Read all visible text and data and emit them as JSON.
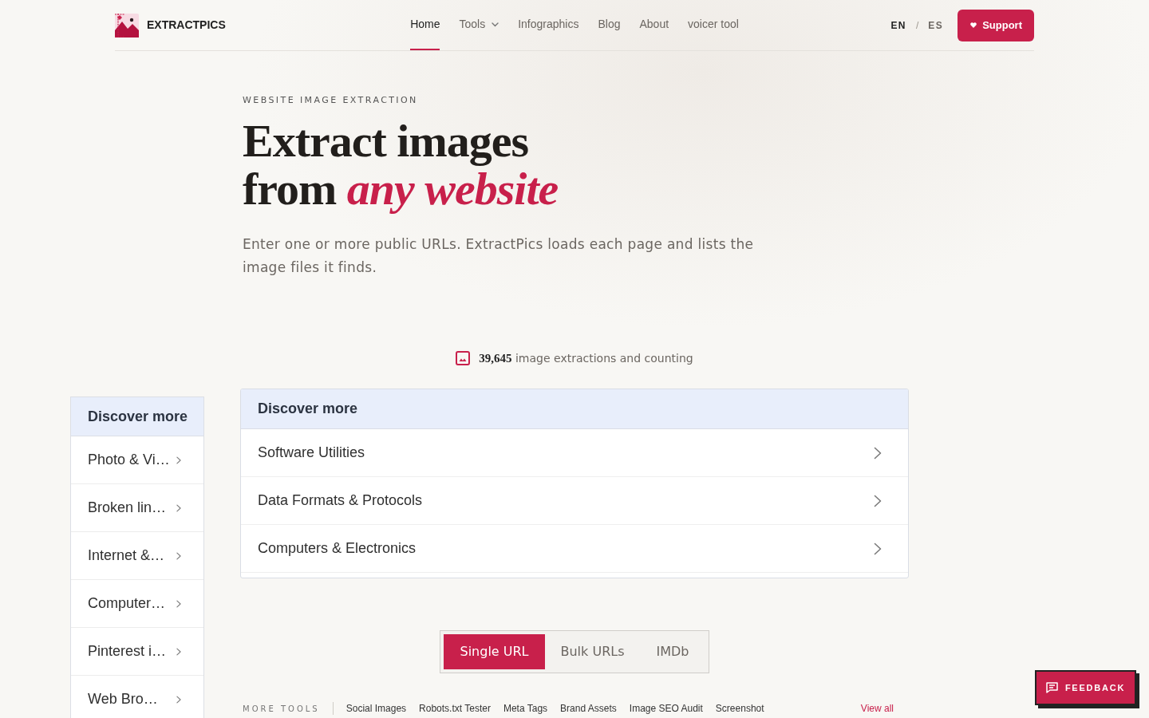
{
  "header": {
    "logo": {
      "text": "EXTRACTPICS"
    },
    "nav": [
      {
        "label": "Home",
        "kind": "link",
        "selected": true
      },
      {
        "label": "Tools",
        "kind": "dropdown",
        "selected": false
      },
      {
        "label": "Infographics",
        "kind": "link",
        "selected": false
      },
      {
        "label": "Blog",
        "kind": "link",
        "selected": false
      },
      {
        "label": "About",
        "kind": "link",
        "selected": false
      },
      {
        "label": "voicer tool",
        "kind": "link",
        "selected": false
      }
    ],
    "languages": [
      {
        "label": "EN",
        "selected": true
      },
      {
        "label": "ES",
        "selected": false
      }
    ],
    "language_separator": "/",
    "support_button": {
      "label": "Support"
    }
  },
  "hero": {
    "eyebrow": "WEBSITE IMAGE EXTRACTION",
    "title_lines": [
      "Extract images",
      "from *any website*"
    ],
    "description": "Enter one or more public URLs. ExtractPics loads each page and lists the image files it finds."
  },
  "counter": {
    "text": "**39,645** image extractions and counting"
  },
  "sidebar": {
    "title": "Discover more",
    "items": [
      {
        "label": "Photo & Vi…"
      },
      {
        "label": "Broken lin…"
      },
      {
        "label": "Internet &…"
      },
      {
        "label": "Computer…"
      },
      {
        "label": "Pinterest i…"
      },
      {
        "label": "Web Bro…"
      }
    ]
  },
  "discover_panel": {
    "title": "Discover more",
    "items": [
      {
        "label": "Software Utilities"
      },
      {
        "label": "Data Formats & Protocols"
      },
      {
        "label": "Computers & Electronics"
      }
    ]
  },
  "mode_tabs": [
    {
      "label": "Single URL",
      "selected": true
    },
    {
      "label": "Bulk URLs",
      "selected": false
    },
    {
      "label": "IMDb",
      "selected": false
    }
  ],
  "more_tools": {
    "title": "MORE TOOLS",
    "links": [
      "Social Images",
      "Robots.txt Tester",
      "Meta Tags",
      "Brand Assets",
      "Image SEO Audit",
      "Screenshot"
    ],
    "view_all": "View all"
  },
  "feedback_button": {
    "label": "FEEDBACK"
  }
}
